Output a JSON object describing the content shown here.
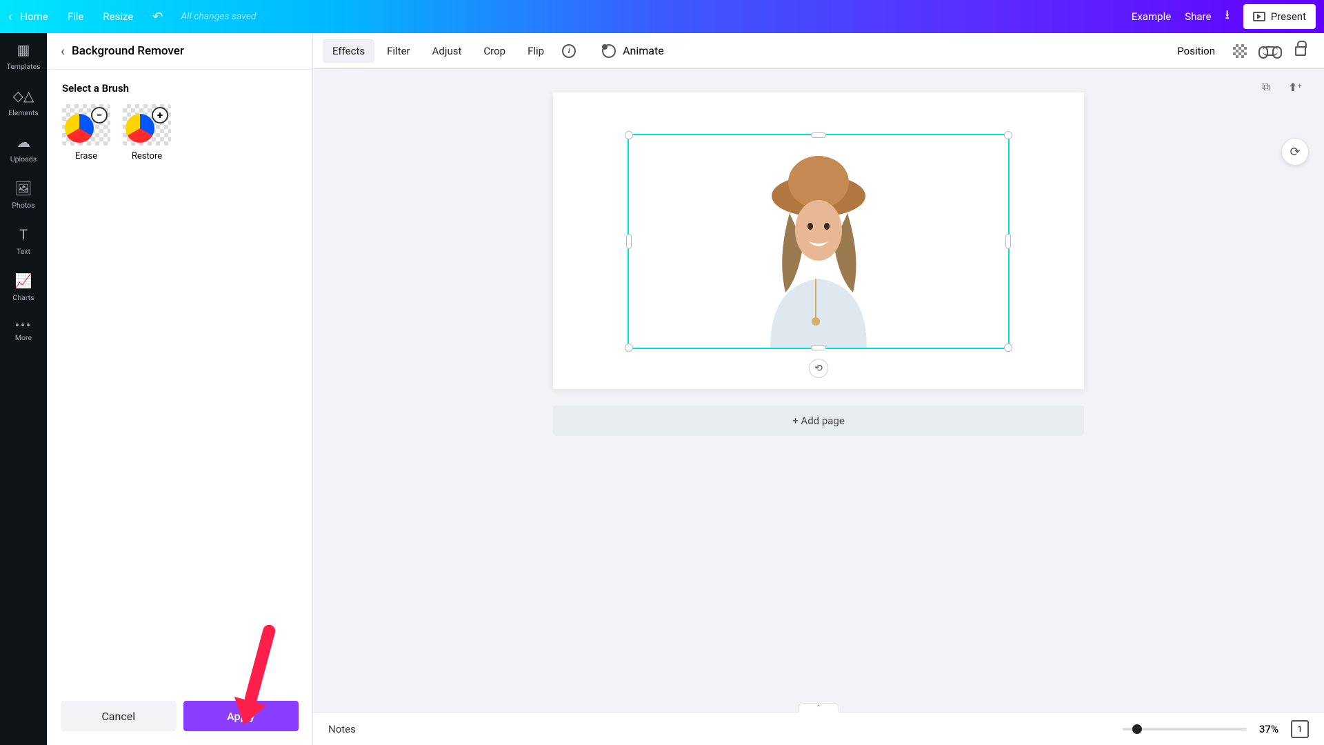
{
  "topbar": {
    "home": "Home",
    "file": "File",
    "resize": "Resize",
    "saved": "All changes saved",
    "example": "Example",
    "share": "Share",
    "present": "Present"
  },
  "leftrail": {
    "items": [
      {
        "label": "Templates"
      },
      {
        "label": "Elements"
      },
      {
        "label": "Uploads"
      },
      {
        "label": "Photos"
      },
      {
        "label": "Text"
      },
      {
        "label": "Charts"
      },
      {
        "label": "More"
      }
    ]
  },
  "sidepanel": {
    "title": "Background Remover",
    "subtitle": "Select a Brush",
    "brushes": {
      "erase": "Erase",
      "restore": "Restore"
    },
    "cancel": "Cancel",
    "apply": "Apply"
  },
  "toolbar": {
    "effects": "Effects",
    "filter": "Filter",
    "adjust": "Adjust",
    "crop": "Crop",
    "flip": "Flip",
    "animate": "Animate",
    "position": "Position"
  },
  "canvas": {
    "addpage": "+ Add page"
  },
  "bottombar": {
    "notes": "Notes",
    "zoom_pct": "37%",
    "page_num": "1"
  }
}
